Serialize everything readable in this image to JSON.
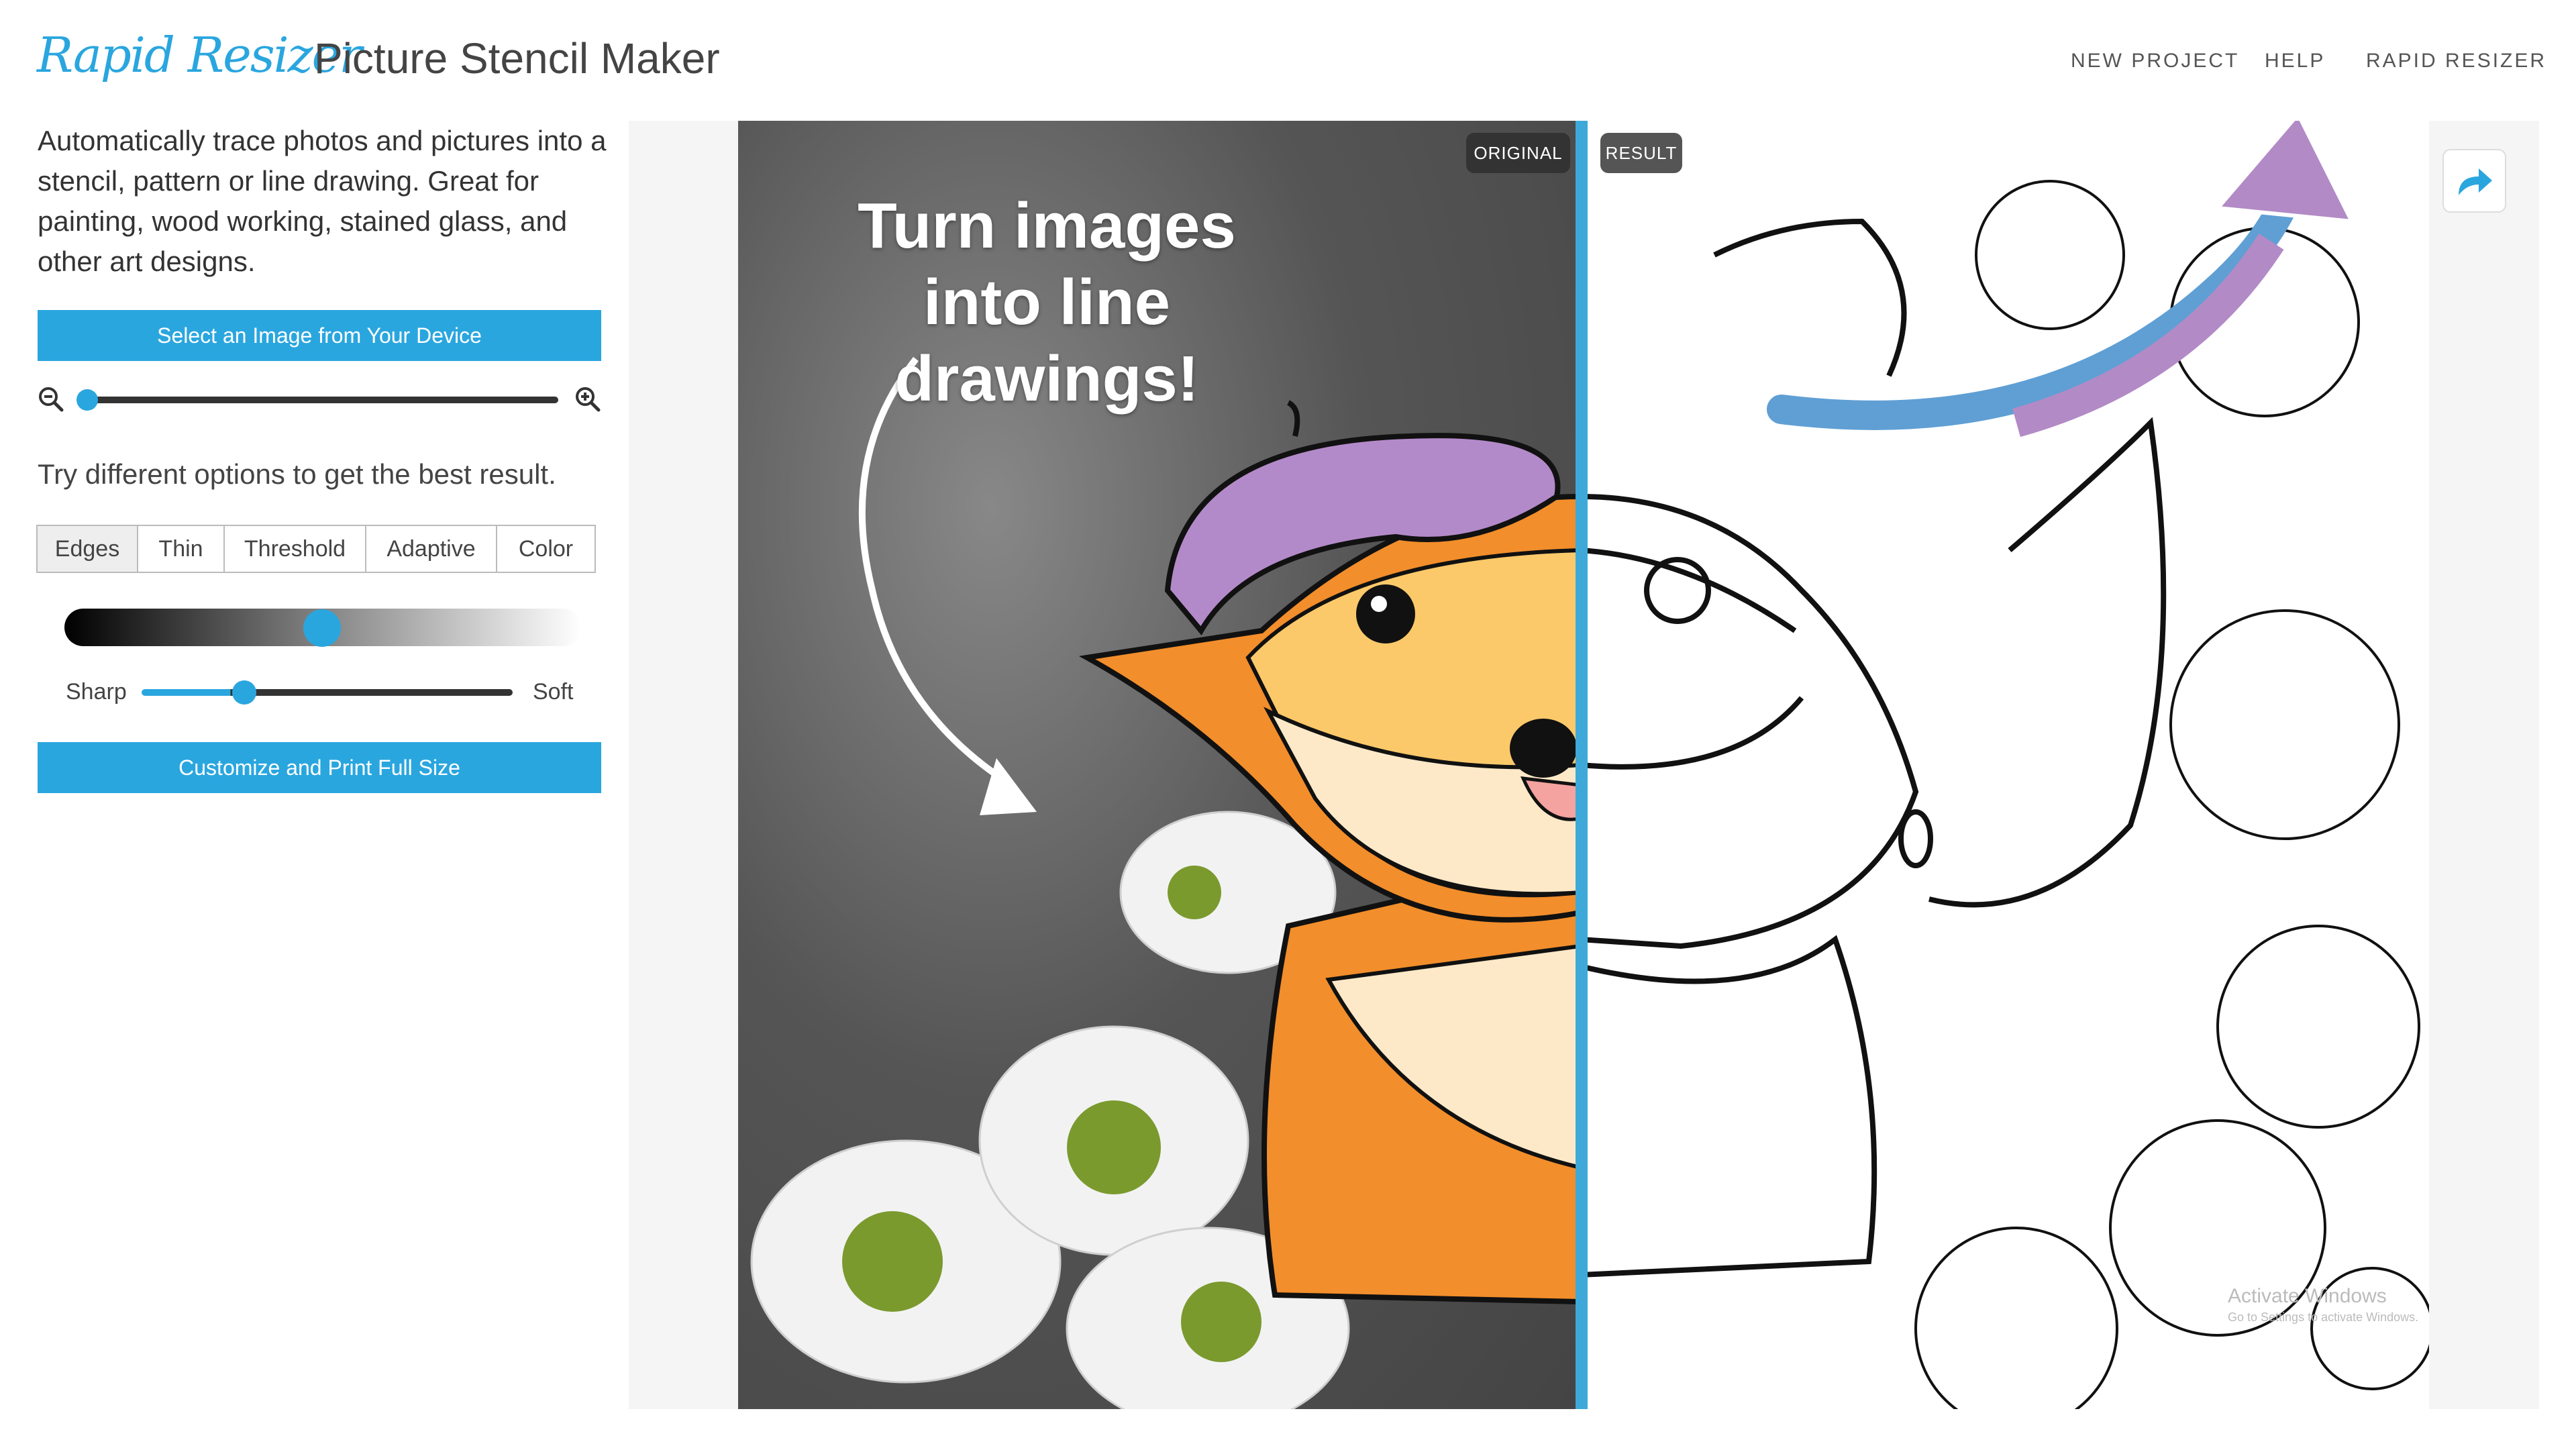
{
  "header": {
    "logo": "Rapid Resizer",
    "app_title": "Picture Stencil Maker",
    "nav": [
      "NEW PROJECT",
      "HELP",
      "RAPID RESIZER"
    ]
  },
  "sidebar": {
    "intro": "Automatically trace photos and pictures into a stencil, pattern or line drawing. Great for painting, wood working, stained glass, and other art designs.",
    "select_button": "Select an Image from Your Device",
    "zoom_level": 0,
    "options_text": "Try different options to get the best result.",
    "tabs": [
      "Edges",
      "Thin",
      "Threshold",
      "Adaptive",
      "Color"
    ],
    "active_tab": "Edges",
    "threshold_level": 0.47,
    "sharp_label": "Sharp",
    "soft_label": "Soft",
    "softness_level": 0.24,
    "print_button": "Customize and Print Full Size"
  },
  "preview": {
    "original_badge": "ORIGINAL",
    "result_badge": "RESULT",
    "headline": "Turn images into line drawings!"
  },
  "watermark": {
    "line1": "Activate Windows",
    "line2": "Go to Settings to activate Windows."
  },
  "colors": {
    "accent": "#2aa6df",
    "divider": "#3ea9d8",
    "arrow": "#b28ac6"
  },
  "icons": [
    "zoom-out-icon",
    "zoom-in-icon",
    "share-icon",
    "curved-arrow-icon"
  ]
}
